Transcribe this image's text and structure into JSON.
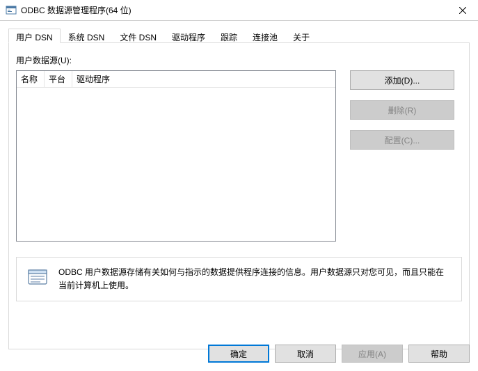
{
  "window": {
    "title": "ODBC 数据源管理程序(64 位)"
  },
  "tabs": [
    {
      "label": "用户 DSN",
      "active": true
    },
    {
      "label": "系统 DSN",
      "active": false
    },
    {
      "label": "文件 DSN",
      "active": false
    },
    {
      "label": "驱动程序",
      "active": false
    },
    {
      "label": "跟踪",
      "active": false
    },
    {
      "label": "连接池",
      "active": false
    },
    {
      "label": "关于",
      "active": false
    }
  ],
  "panel": {
    "list_label": "用户数据源(U):",
    "columns": {
      "name": "名称",
      "platform": "平台",
      "driver": "驱动程序"
    },
    "buttons": {
      "add": "添加(D)...",
      "remove": "删除(R)",
      "configure": "配置(C)..."
    },
    "info": "ODBC 用户数据源存储有关如何与指示的数据提供程序连接的信息。用户数据源只对您可见，而且只能在当前计算机上使用。"
  },
  "footer": {
    "ok": "确定",
    "cancel": "取消",
    "apply": "应用(A)",
    "help": "帮助"
  }
}
